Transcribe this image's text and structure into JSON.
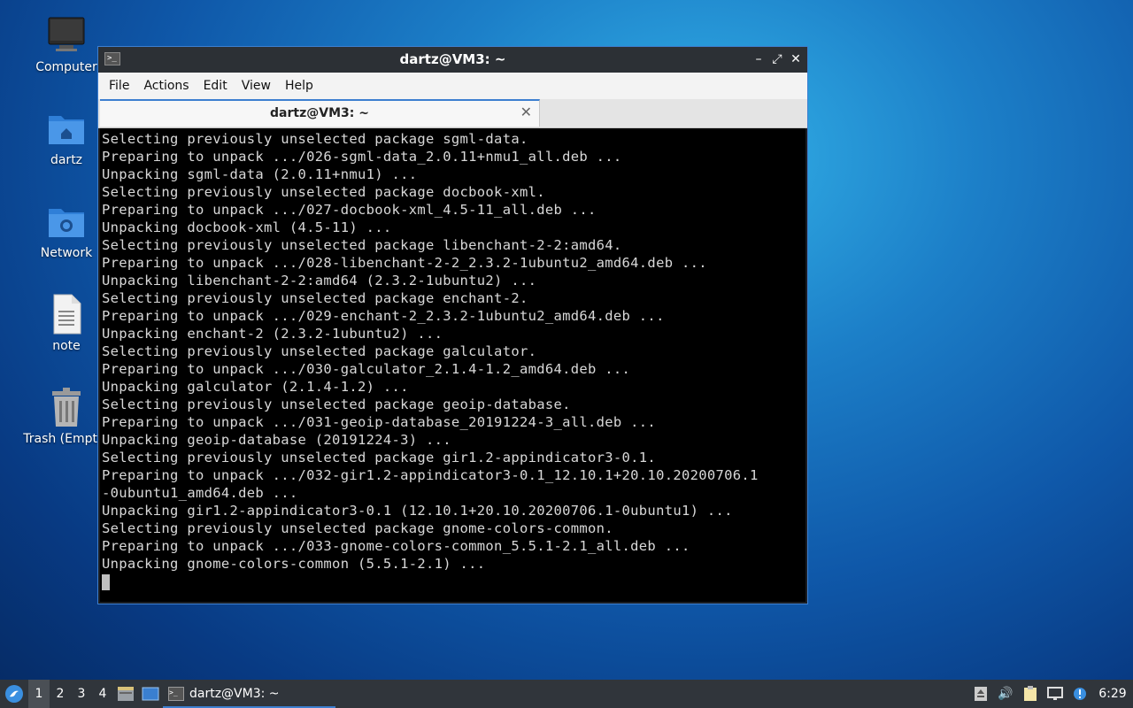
{
  "desktop": {
    "icons": [
      {
        "label": "Computer"
      },
      {
        "label": "dartz"
      },
      {
        "label": "Network"
      },
      {
        "label": "note"
      },
      {
        "label": "Trash (Empty)"
      }
    ]
  },
  "window": {
    "title": "dartz@VM3: ~",
    "menu": [
      "File",
      "Actions",
      "Edit",
      "View",
      "Help"
    ],
    "tab_title": "dartz@VM3: ~",
    "terminal_lines": [
      "Selecting previously unselected package sgml-data.",
      "Preparing to unpack .../026-sgml-data_2.0.11+nmu1_all.deb ...",
      "Unpacking sgml-data (2.0.11+nmu1) ...",
      "Selecting previously unselected package docbook-xml.",
      "Preparing to unpack .../027-docbook-xml_4.5-11_all.deb ...",
      "Unpacking docbook-xml (4.5-11) ...",
      "Selecting previously unselected package libenchant-2-2:amd64.",
      "Preparing to unpack .../028-libenchant-2-2_2.3.2-1ubuntu2_amd64.deb ...",
      "Unpacking libenchant-2-2:amd64 (2.3.2-1ubuntu2) ...",
      "Selecting previously unselected package enchant-2.",
      "Preparing to unpack .../029-enchant-2_2.3.2-1ubuntu2_amd64.deb ...",
      "Unpacking enchant-2 (2.3.2-1ubuntu2) ...",
      "Selecting previously unselected package galculator.",
      "Preparing to unpack .../030-galculator_2.1.4-1.2_amd64.deb ...",
      "Unpacking galculator (2.1.4-1.2) ...",
      "Selecting previously unselected package geoip-database.",
      "Preparing to unpack .../031-geoip-database_20191224-3_all.deb ...",
      "Unpacking geoip-database (20191224-3) ...",
      "Selecting previously unselected package gir1.2-appindicator3-0.1.",
      "Preparing to unpack .../032-gir1.2-appindicator3-0.1_12.10.1+20.10.20200706.1",
      "-0ubuntu1_amd64.deb ...",
      "Unpacking gir1.2-appindicator3-0.1 (12.10.1+20.10.20200706.1-0ubuntu1) ...",
      "Selecting previously unselected package gnome-colors-common.",
      "Preparing to unpack .../033-gnome-colors-common_5.5.1-2.1_all.deb ...",
      "Unpacking gnome-colors-common (5.5.1-2.1) ..."
    ]
  },
  "taskbar": {
    "workspaces": [
      "1",
      "2",
      "3",
      "4"
    ],
    "active_workspace": "1",
    "task_label": "dartz@VM3: ~",
    "clock": "6:29"
  },
  "colors": {
    "accent": "#3d7fd0",
    "terminal_bg": "#000000",
    "terminal_fg": "#d8d8d8",
    "taskbar_bg": "#30353b"
  }
}
